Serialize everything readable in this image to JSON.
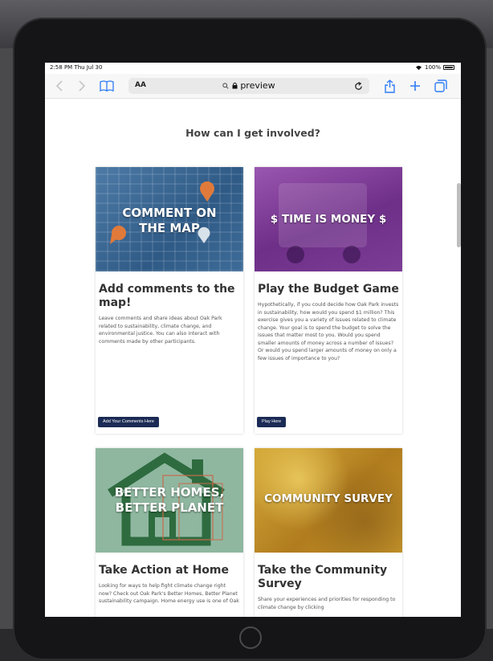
{
  "status_bar": {
    "time": "2:58 PM",
    "date": "Thu Jul 30",
    "battery": "100%"
  },
  "browser": {
    "text_size_label": "AA",
    "address": "preview"
  },
  "page": {
    "heading": "How can I get involved?",
    "cards": [
      {
        "image_label_line1": "COMMENT ON",
        "image_label_line2": "THE MAP",
        "title": "Add comments to the map!",
        "text": "Leave comments and share ideas about Oak Park related to sustainability, climate change, and environmental justice. You can also interact with comments made by other participants.",
        "button": "Add Your Comments Here"
      },
      {
        "image_label_line1": "$ TIME IS MONEY $",
        "title": "Play the Budget Game",
        "text": "Hypothetically, if you could decide how Oak Park invests in sustainability, how would you spend $1 million? This exercise gives you a variety of issues related to climate change. Your goal is to spend the budget to solve the issues that matter most to you. Would you spend smaller amounts of money across a number of issues? Or would you spend larger amounts of money on only a few issues of importance to you?",
        "button": "Play Here"
      },
      {
        "image_label_line1": "BETTER HOMES,",
        "image_label_line2": "BETTER PLANET",
        "title": "Take Action at Home",
        "text": "Looking for ways to help fight climate change right now? Check out Oak Park's Better Homes, Better Planet sustainability campaign. Home energy use is one of Oak"
      },
      {
        "image_label_line1": "COMMUNITY SURVEY",
        "title": "Take the Community Survey",
        "text": "Share your experiences and priorities for responding to climate change by clicking"
      }
    ]
  },
  "colors": {
    "accent": "#2f7cf6",
    "button_bg": "#1b2b55",
    "map_card": "#3a6a98",
    "budget_card": "#7d3a97",
    "homes_card": "#8fb7a0",
    "survey_card": "#c99a2a"
  }
}
